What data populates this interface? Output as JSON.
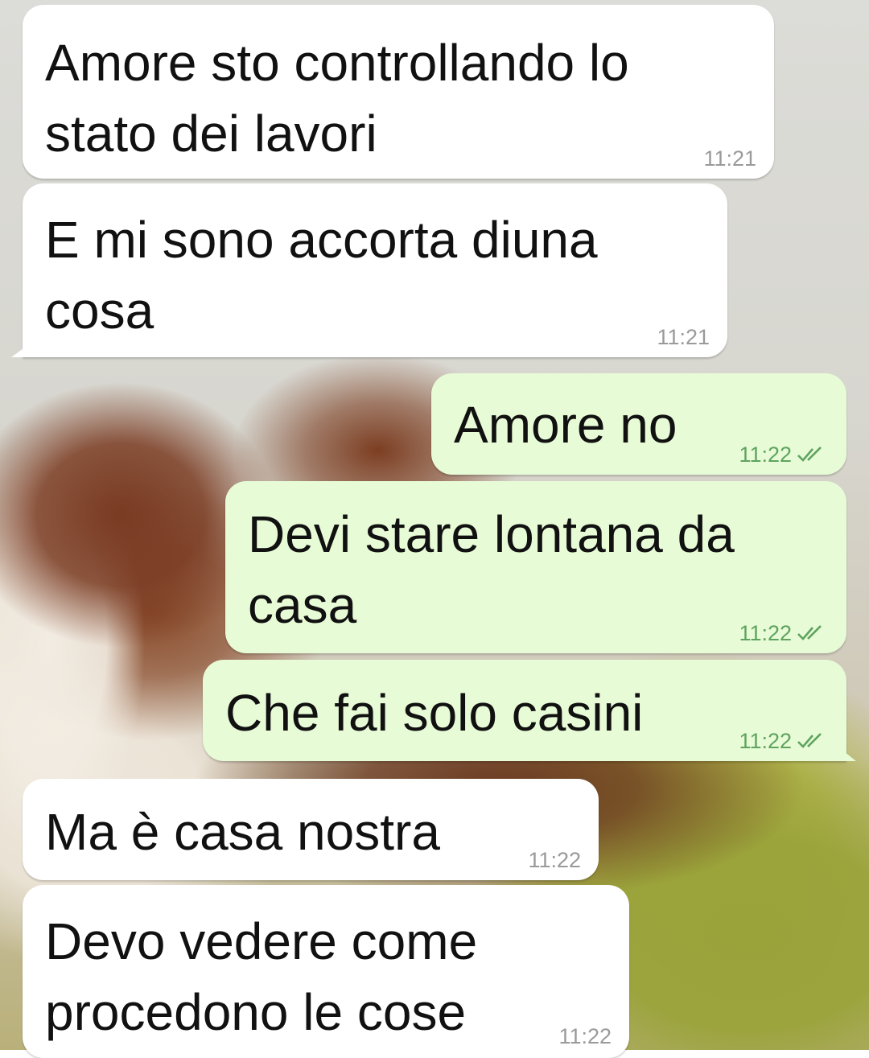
{
  "messages": [
    {
      "direction": "in",
      "text": "Amore sto controllando lo\nstato dei lavori",
      "time": "11:21"
    },
    {
      "direction": "in",
      "text": "E mi sono accorta diuna\ncosa",
      "time": "11:21"
    },
    {
      "direction": "out",
      "text": "Amore no",
      "time": "11:22",
      "status_icon": "double-check-icon"
    },
    {
      "direction": "out",
      "text": "Devi stare lontana da\ncasa",
      "time": "11:22",
      "status_icon": "double-check-icon"
    },
    {
      "direction": "out",
      "text": "Che fai solo casini",
      "time": "11:22",
      "status_icon": "double-check-icon"
    },
    {
      "direction": "in",
      "text": "Ma è casa nostra",
      "time": "11:22"
    },
    {
      "direction": "in",
      "text": "Devo vedere come\nprocedono le cose",
      "time": "11:22"
    }
  ],
  "colors": {
    "incoming_bubble": "#ffffff",
    "outgoing_bubble": "#e7fbd6",
    "tick_color": "#5fa35f",
    "time_in": "#9a9a9a"
  }
}
